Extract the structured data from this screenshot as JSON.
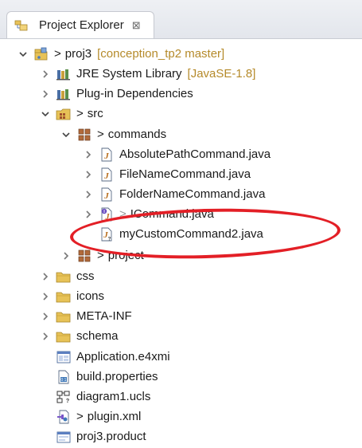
{
  "view": {
    "tab_label": "Project Explorer",
    "tab_close": "⊠"
  },
  "tree": {
    "project": {
      "prefix": ">",
      "label": "proj3",
      "decor": "[conception_tp2 master]"
    },
    "jre": {
      "label": "JRE System Library",
      "decor": "[JavaSE-1.8]"
    },
    "plugin_deps": {
      "label": "Plug-in Dependencies"
    },
    "src": {
      "prefix": ">",
      "label": "src"
    },
    "commands_pkg": {
      "prefix": ">",
      "label": "commands"
    },
    "files": [
      {
        "label": "AbsolutePathCommand.java"
      },
      {
        "label": "FileNameCommand.java"
      },
      {
        "label": "FolderNameCommand.java"
      },
      {
        "prefix": ">",
        "label": "ICommand.java"
      },
      {
        "label": "myCustomCommand2.java"
      }
    ],
    "project_pkg": {
      "prefix": ">",
      "label": "project"
    },
    "folders": [
      {
        "label": "css"
      },
      {
        "label": "icons"
      },
      {
        "label": "META-INF"
      },
      {
        "label": "schema"
      }
    ],
    "root_files": [
      {
        "label": "Application.e4xmi"
      },
      {
        "label": "build.properties"
      },
      {
        "label": "diagram1.ucls"
      },
      {
        "prefix": ">",
        "label": "plugin.xml"
      },
      {
        "label": "proj3.product"
      }
    ]
  },
  "colors": {
    "decor": "#b58a2a",
    "highlight": "#e31f26"
  }
}
